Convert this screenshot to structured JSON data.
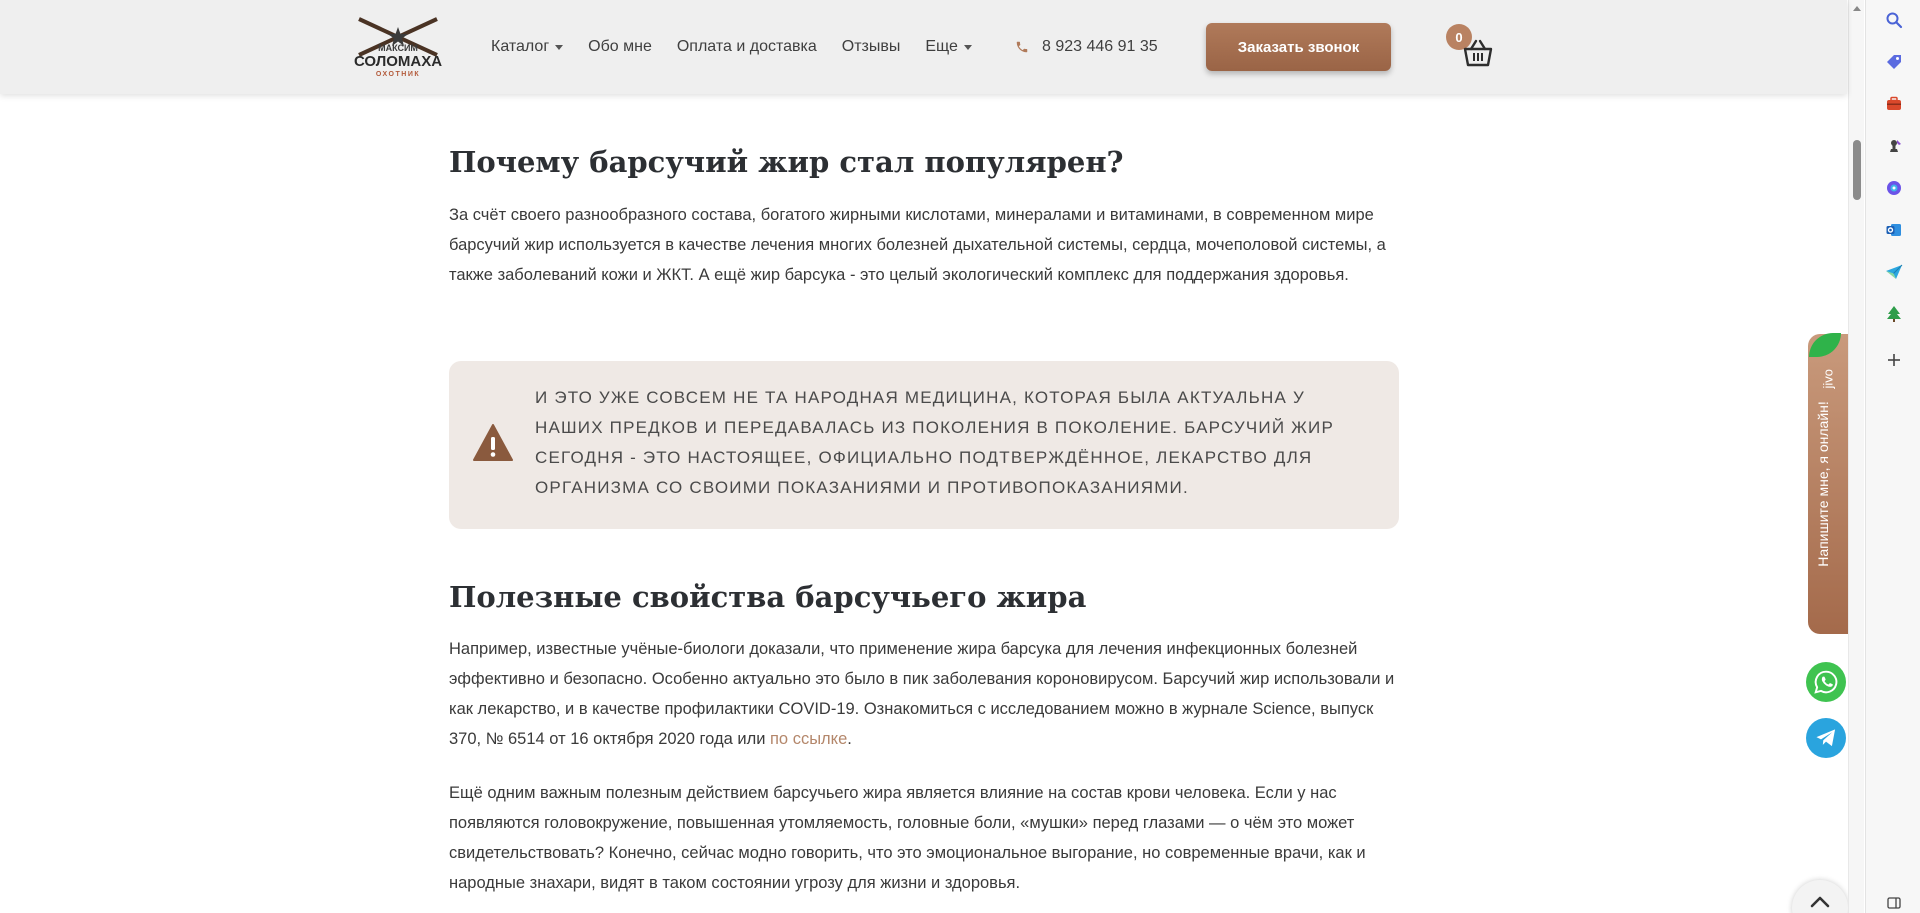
{
  "header": {
    "logo": {
      "line1": "МАКСИМ",
      "line2": "СОЛОМАХА",
      "line3": "ОХОТНИК"
    },
    "nav": [
      {
        "label": "Каталог",
        "dropdown": true
      },
      {
        "label": "Обо мне",
        "dropdown": false
      },
      {
        "label": "Оплата и доставка",
        "dropdown": false
      },
      {
        "label": "Отзывы",
        "dropdown": false
      },
      {
        "label": "Еще",
        "dropdown": true
      }
    ],
    "phone": "8 923 446 91 35",
    "call_button": "Заказать звонок",
    "cart_count": "0"
  },
  "article": {
    "heading1": "Почему барсучий жир стал популярен?",
    "para1": "За счёт своего разнообразного состава, богатого жирными кислотами, минералами и витаминами, в современном мире барсучий жир используется в качестве лечения многих болезней дыхательной системы, сердца, мочеполовой системы, а также заболеваний кожи и ЖКТ. А ещё жир барсука - это целый экологический комплекс для поддержания здоровья.",
    "notice": "И это уже совсем не та народная медицина, которая была актуальна у наших предков и передавалась из поколения в поколение. Барсучий жир сегодня - это настоящее, официально подтверждённое, лекарство для организма со своими показаниями и противопоказаниями.",
    "heading2": "Полезные свойства барсучьего жира",
    "para2": "Например, известные учёные-биологи доказали, что применение жира барсука для лечения инфекционных болезней эффективно и безопасно. Особенно актуально это было в пик заболевания короновирусом. Барсучий жир использовали и как лекарство, и в качестве профилактики COVID-19. Ознакомиться с исследованием можно в журнале Science, выпуск 370, № 6514 от 16 октября 2020 года или ",
    "para2_link": "по ссылке",
    "para2_end": ".",
    "para3": "Ещё одним важным полезным действием барсучьего жира является влияние на состав крови человека. Если у нас появляются головокружение, повышенная утомляемость, головные боли, «мушки» перед глазами — о чём это может свидетельствовать? Конечно, сейчас модно говорить, что это эмоциональное выгорание, но современные врачи, как и народные знахари, видят в таком состоянии угрозу для жизни и здоровья."
  },
  "chat_widget": {
    "brand": "jivo",
    "label": "Напишите мне, я онлайн!"
  },
  "colors": {
    "accent": "#b07a5a",
    "notice_bg": "#efe9e5",
    "link": "#b4876b",
    "whatsapp": "#3fc350",
    "telegram": "#2aa4de"
  },
  "side_panel_icons": [
    "search-icon",
    "tag-icon",
    "briefcase-icon",
    "chess-icon",
    "copilot-icon",
    "outlook-icon",
    "send-icon",
    "tree-icon",
    "plus-icon",
    "sidebar-toggle-icon"
  ]
}
